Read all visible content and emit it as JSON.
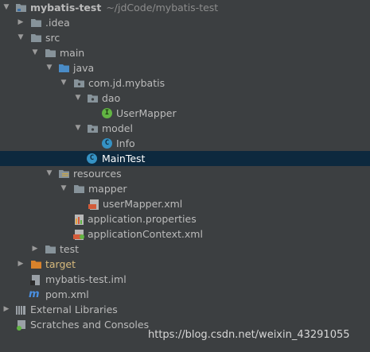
{
  "tree": {
    "project": {
      "name": "mybatis-test",
      "path": "~/jdCode/mybatis-test"
    },
    "idea": ".idea",
    "src": "src",
    "main": "main",
    "java": "java",
    "package": "com.jd.mybatis",
    "dao": "dao",
    "user_mapper": "UserMapper",
    "model": "model",
    "info": "Info",
    "main_test": "MainTest",
    "resources": "resources",
    "mapper": "mapper",
    "user_mapper_xml": "userMapper.xml",
    "application_properties": "application.properties",
    "application_context": "applicationContext.xml",
    "test": "test",
    "target": "target",
    "iml": "mybatis-test.iml",
    "pom": "pom.xml",
    "external_libraries": "External Libraries",
    "scratches": "Scratches and Consoles"
  },
  "icons": {
    "interface_letter": "I",
    "class_letter": "C",
    "maven_letter": "m"
  },
  "colors": {
    "background": "#3c3f41",
    "selection": "#0d293e",
    "text": "#bbbbbb",
    "target_text": "#d7ba7d"
  },
  "watermark": "https://blog.csdn.net/weixin_43291055"
}
